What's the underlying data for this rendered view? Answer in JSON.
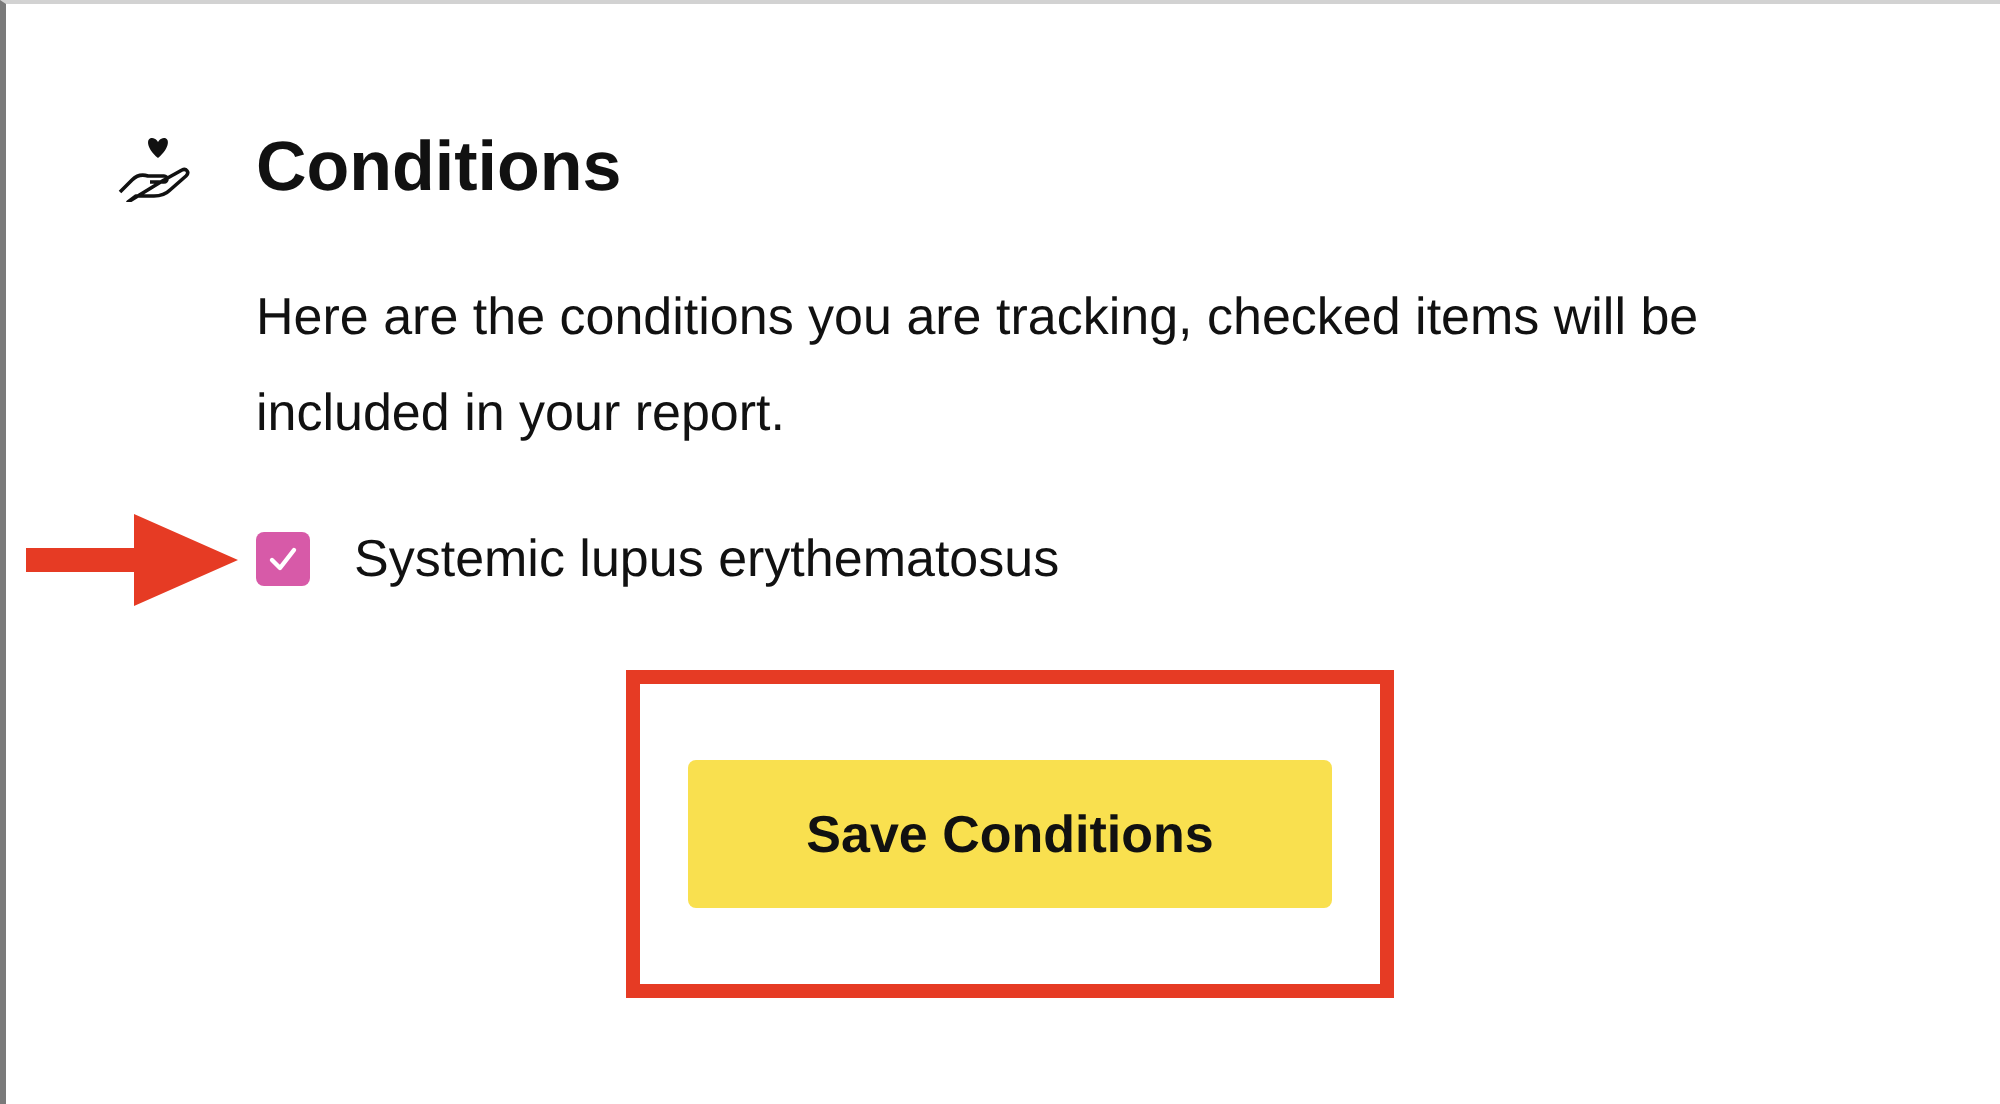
{
  "section": {
    "title": "Conditions",
    "description": "Here are the conditions you are tracking, checked items will be included in your report."
  },
  "conditions": [
    {
      "label": "Systemic lupus erythematosus",
      "checked": true
    }
  ],
  "save_button": {
    "label": "Save Conditions"
  }
}
